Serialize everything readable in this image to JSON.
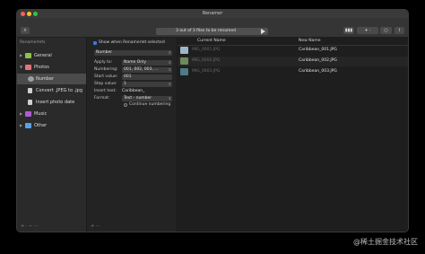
{
  "window": {
    "title": "Renamer"
  },
  "toolbar": {
    "status": "3 out of 3 files to be renamed",
    "right_buttons": [
      "▮▮▮",
      "+ ·",
      "○",
      "i"
    ]
  },
  "sidebar": {
    "header": "Renamerlets",
    "items": [
      {
        "label": "General",
        "icon": "cube-icon",
        "color": "#8bc34a",
        "selected": false
      },
      {
        "label": "Photos",
        "icon": "photo-icon",
        "color": "#e57373",
        "selected": false
      },
      {
        "label": "Number",
        "icon": "number-icon",
        "color": "#9e9e9e",
        "selected": true
      },
      {
        "label": "Convert .JPEG to .jpg",
        "icon": "document-icon",
        "color": "#cfcfcf",
        "selected": false
      },
      {
        "label": "Insert photo date",
        "icon": "document-icon",
        "color": "#cfcfcf",
        "selected": false
      },
      {
        "label": "Music",
        "icon": "music-icon",
        "color": "#b05ad6",
        "selected": false
      },
      {
        "label": "Other",
        "icon": "other-icon",
        "color": "#5aa0e6",
        "selected": false
      }
    ],
    "footer": "+ · −   ⋯"
  },
  "editor": {
    "show_label": "Show when Renamerlet selected",
    "group_select": "Number",
    "rows": [
      {
        "label": "Apply to:",
        "value": "Name Only",
        "kind": "select"
      },
      {
        "label": "Numbering:",
        "value": "001, 002, 003, ...",
        "kind": "select"
      },
      {
        "label": "Start value:",
        "value": "001",
        "kind": "input"
      },
      {
        "label": "Step value:",
        "value": "1",
        "kind": "input"
      },
      {
        "label": "Insert text:",
        "value": "Caribbean_",
        "kind": "text"
      },
      {
        "label": "Format:",
        "value": "Text - number",
        "kind": "select"
      }
    ],
    "continue_label": "Continue numbering",
    "footer": "+ ···"
  },
  "table": {
    "headers": {
      "current": "Current Name",
      "new": "New Name"
    },
    "rows": [
      {
        "current": "IMG_0001.JPG",
        "new": "Caribbean_001.JPG",
        "thumb_color": "#9fb6c8"
      },
      {
        "current": "IMG_0002.JPG",
        "new": "Caribbean_002.JPG",
        "thumb_color": "#6e8a5a"
      },
      {
        "current": "IMG_0003.JPG",
        "new": "Caribbean_003.JPG",
        "thumb_color": "#4f7a86"
      }
    ]
  },
  "watermark": "@稀土掘金技术社区"
}
